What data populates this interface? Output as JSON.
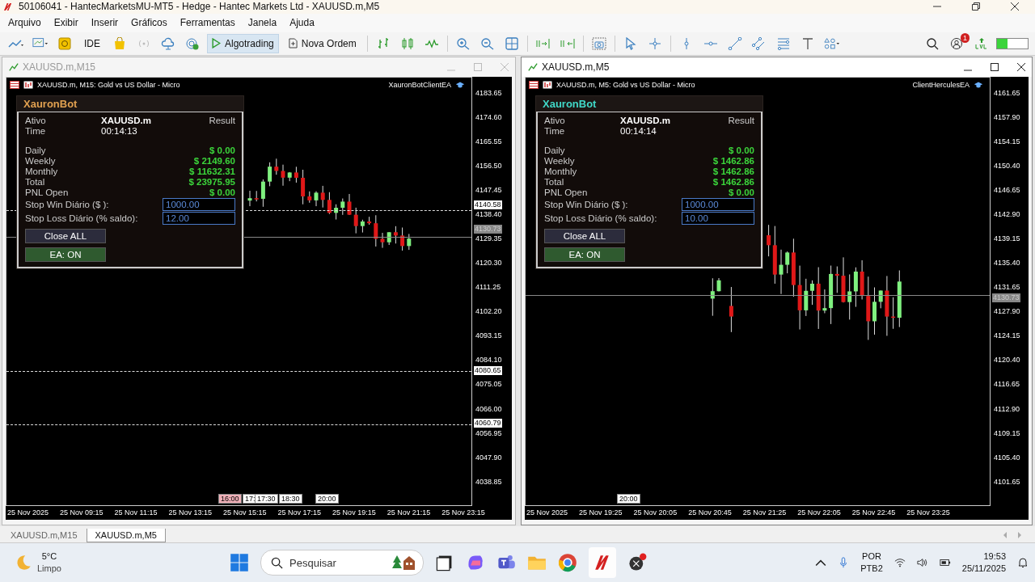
{
  "window": {
    "title": "50106041 - HantecMarketsMU-MT5 - Hedge - Hantec Markets Ltd - XAUUSD.m,M5"
  },
  "menu": [
    "Arquivo",
    "Exibir",
    "Inserir",
    "Gráficos",
    "Ferramentas",
    "Janela",
    "Ajuda"
  ],
  "toolbar": {
    "buttons": [
      {
        "label": "IDE",
        "selected": false
      },
      {
        "label": "Algotrading",
        "selected": true
      },
      {
        "label": "Nova Ordem",
        "selected": false
      }
    ],
    "notification_badge": "1",
    "level": 0.35
  },
  "charts": [
    {
      "title": "XAUUSD.m,M15",
      "active": false,
      "symbol_label": "XAUUSD.m, M15:  Gold vs US Dollar - Micro",
      "ea_name": "XauronBotClientEA",
      "panel": {
        "title": "XauronBot",
        "color": "#e0a050",
        "asset_label": "Ativo",
        "asset": "XAUUSD.m",
        "result_label": "Result",
        "time_label": "Time",
        "time": "00:14:13",
        "rows": [
          {
            "label": "Daily",
            "value": "$ 0.00"
          },
          {
            "label": "Weekly",
            "value": "$ 2149.60"
          },
          {
            "label": "Monthly",
            "value": "$ 11632.31"
          },
          {
            "label": "Total",
            "value": "$ 23975.95"
          },
          {
            "label": "PNL Open",
            "value": "$ 0.00"
          }
        ],
        "inputs": [
          {
            "label": "Stop Win Diário ($ ):",
            "value": "1000.00"
          },
          {
            "label": "Stop Loss Diário (% saldo):",
            "value": "12.00"
          }
        ],
        "buttons": [
          {
            "label": "Close ALL",
            "kind": "action"
          },
          {
            "label": "EA: ON",
            "kind": "toggle"
          }
        ]
      },
      "price_ticks": [
        "4183.65",
        "4174.60",
        "4165.55",
        "4156.50",
        "4147.45",
        "4138.40",
        "4129.35",
        "4120.30",
        "4111.25",
        "4102.20",
        "4093.15",
        "4084.10",
        "4075.05",
        "4066.00",
        "4056.95",
        "4047.90",
        "4038.85"
      ],
      "price_tags": [
        {
          "value": "4140.58",
          "kind": "level"
        },
        {
          "value": "4130.73",
          "kind": "current"
        },
        {
          "value": "4080.65",
          "kind": "level"
        },
        {
          "value": "4060.79",
          "kind": "level"
        }
      ],
      "time_markers": [
        {
          "label": "16:00",
          "highlighted": true
        },
        {
          "label": "17:",
          "highlighted": false
        },
        {
          "label": "17:30",
          "highlighted": false
        },
        {
          "label": "18:30",
          "highlighted": false
        },
        {
          "label": "20:00",
          "highlighted": false
        }
      ],
      "time_labels": [
        "25 Nov 2025",
        "25 Nov 09:15",
        "25 Nov 11:15",
        "25 Nov 13:15",
        "25 Nov 15:15",
        "25 Nov 17:15",
        "25 Nov 19:15",
        "25 Nov 21:15",
        "25 Nov 23:15"
      ]
    },
    {
      "title": "XAUUSD.m,M5",
      "active": true,
      "symbol_label": "XAUUSD.m, M5:  Gold vs US Dollar - Micro",
      "ea_name": "ClientHerculesEA",
      "panel": {
        "title": "XauronBot",
        "color": "#40d8c8",
        "asset_label": "Ativo",
        "asset": "XAUUSD.m",
        "result_label": "Result",
        "time_label": "Time",
        "time": "00:14:14",
        "rows": [
          {
            "label": "Daily",
            "value": "$ 0.00"
          },
          {
            "label": "Weekly",
            "value": "$ 1462.86"
          },
          {
            "label": "Monthly",
            "value": "$ 1462.86"
          },
          {
            "label": "Total",
            "value": "$ 1462.86"
          },
          {
            "label": "PNL Open",
            "value": "$ 0.00"
          }
        ],
        "inputs": [
          {
            "label": "Stop Win Diário ($ ):",
            "value": "1000.00"
          },
          {
            "label": "Stop Loss Diário (% saldo):",
            "value": "10.00"
          }
        ],
        "buttons": [
          {
            "label": "Close ALL",
            "kind": "action"
          },
          {
            "label": "EA: ON",
            "kind": "toggle"
          }
        ]
      },
      "price_ticks": [
        "4161.65",
        "4157.90",
        "4154.15",
        "4150.40",
        "4146.65",
        "4142.90",
        "4139.15",
        "4135.40",
        "4131.65",
        "4127.90",
        "4124.15",
        "4120.40",
        "4116.65",
        "4112.90",
        "4109.15",
        "4105.40",
        "4101.65"
      ],
      "price_tags": [
        {
          "value": "4130.73",
          "kind": "current"
        }
      ],
      "time_markers": [
        {
          "label": "20:00",
          "highlighted": false
        }
      ],
      "time_labels": [
        "25 Nov 2025",
        "25 Nov 19:25",
        "25 Nov 20:05",
        "25 Nov 20:45",
        "25 Nov 21:25",
        "25 Nov 22:05",
        "25 Nov 22:45",
        "25 Nov 23:25"
      ]
    }
  ],
  "tabs": [
    {
      "label": "XAUUSD.m,M15",
      "selected": false
    },
    {
      "label": "XAUUSD.m,M5",
      "selected": true
    }
  ],
  "taskbar": {
    "temperature": "5°C",
    "weather": "Limpo",
    "search_placeholder": "Pesquisar",
    "language": "POR",
    "layout": "PTB2",
    "time": "19:53",
    "date": "25/11/2025"
  }
}
